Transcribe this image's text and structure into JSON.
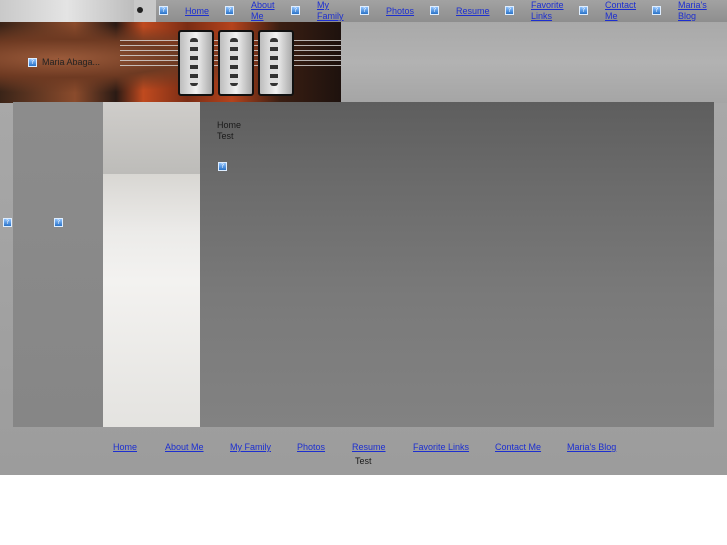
{
  "nav": {
    "items": [
      {
        "label": "Home"
      },
      {
        "label": "About Me"
      },
      {
        "label": "My Family"
      },
      {
        "label": "Photos"
      },
      {
        "label": "Resume"
      },
      {
        "label": "Favorite Links"
      },
      {
        "label": "Contact Me"
      },
      {
        "label": "Maria's Blog"
      }
    ]
  },
  "header": {
    "title": "Maria Abaga..."
  },
  "content": {
    "line1": "Home",
    "line2": "Test"
  },
  "footer": {
    "links": [
      {
        "label": "Home"
      },
      {
        "label": "About Me"
      },
      {
        "label": "My Family"
      },
      {
        "label": "Photos"
      },
      {
        "label": "Resume"
      },
      {
        "label": "Favorite Links"
      },
      {
        "label": "Contact Me"
      },
      {
        "label": "Maria's Blog"
      }
    ],
    "text": "Test"
  },
  "icons": {
    "broken_image": "broken-image-icon"
  },
  "colors": {
    "link": "#1d2fd0",
    "content_bg": "#6b6b6b"
  }
}
